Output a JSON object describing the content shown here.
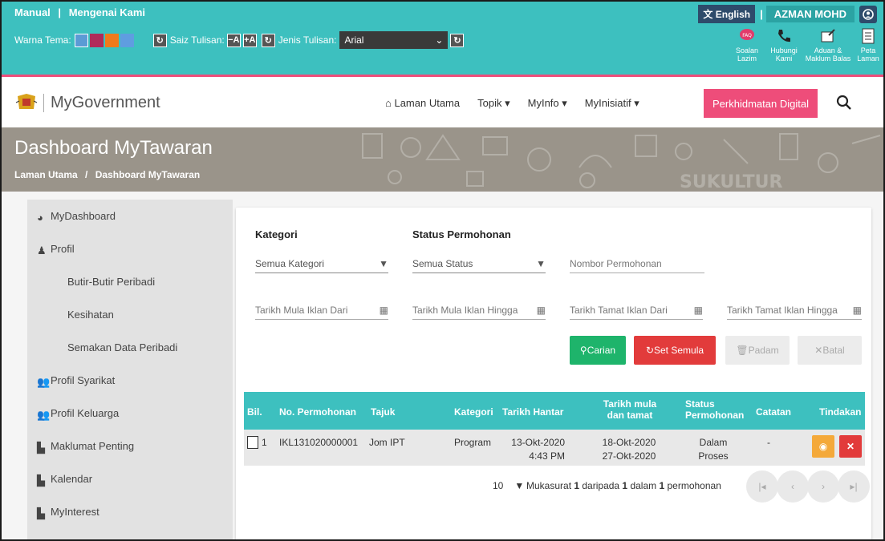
{
  "top": {
    "links": [
      "Manual",
      "|",
      "Mengenai Kami"
    ],
    "theme_label": "Warna Tema:",
    "theme_colors": [
      "#5b9bd5",
      "#b02a5a",
      "#f07a1b",
      "#5f9de0"
    ],
    "font_size_label": "Saiz Tulisan:",
    "font_minus": "−A",
    "font_plus": "+A",
    "font_type_label": "Jenis Tulisan:",
    "font_value": "Arial",
    "lang_label": "English",
    "user_sep": "|",
    "user_name": "AZMAN MOHD",
    "quick": [
      {
        "label": "Soalan Lazim",
        "icon": "faq-icon"
      },
      {
        "label": "Hubungi Kami",
        "icon": "phone-icon"
      },
      {
        "label": "Aduan & Maklum Balas",
        "icon": "feedback-icon"
      },
      {
        "label": "Peta Laman",
        "icon": "sitemap-icon"
      }
    ]
  },
  "nav": {
    "logo_text": "MyGovernment",
    "menu": [
      "Laman Utama",
      "Topik",
      "MyInfo",
      "MyInisiatif"
    ],
    "digital_button": "Perkhidmatan Digital"
  },
  "banner": {
    "title": "Dashboard MyTawaran",
    "crumb_home": "Laman Utama",
    "crumb_sep": "/",
    "crumb_current": "Dashboard MyTawaran",
    "deco_text": "SUKULTUR"
  },
  "sidebar": [
    {
      "label": "MyDashboard",
      "icon": "dashboard-icon",
      "sub": false
    },
    {
      "label": "Profil",
      "icon": "user-icon",
      "sub": false
    },
    {
      "label": "Butir-Butir Peribadi",
      "icon": "",
      "sub": true
    },
    {
      "label": "Kesihatan",
      "icon": "",
      "sub": true
    },
    {
      "label": "Semakan Data Peribadi",
      "icon": "",
      "sub": true
    },
    {
      "label": "Profil Syarikat",
      "icon": "group-icon",
      "sub": false
    },
    {
      "label": "Profil Keluarga",
      "icon": "group-icon",
      "sub": false
    },
    {
      "label": "Maklumat Penting",
      "icon": "file-icon",
      "sub": false
    },
    {
      "label": "Kalendar",
      "icon": "file-icon",
      "sub": false
    },
    {
      "label": "MyInterest",
      "icon": "file-icon",
      "sub": false
    }
  ],
  "filters": {
    "kategori_label": "Kategori",
    "status_label": "Status Permohonan",
    "kategori_value": "Semua Kategori",
    "status_value": "Semua Status",
    "nombor_placeholder": "Nombor Permohonan",
    "tarikh_mula_dari": "Tarikh Mula Iklan Dari",
    "tarikh_mula_hingga": "Tarikh Mula Iklan Hingga",
    "tarikh_tamat_dari": "Tarikh Tamat Iklan Dari",
    "tarikh_tamat_hingga": "Tarikh Tamat Iklan Hingga",
    "btn_carian": "Carian",
    "btn_set_semula": "Set Semula",
    "btn_padam": "Padam",
    "btn_batal": "Batal"
  },
  "table": {
    "headers": [
      "Bil.",
      "No. Permohonan",
      "Tajuk",
      "Kategori",
      "Tarikh Hantar",
      "Tarikh mula dan tamat",
      "Status Permohonan",
      "Catatan",
      "Tindakan"
    ],
    "rows": [
      {
        "bil": "1",
        "no": "IKL131020000001",
        "tajuk": "Jom IPT",
        "kategori": "Program",
        "hantar_date": "13-Okt-2020",
        "hantar_time": "4:43 PM",
        "mula": "18-Okt-2020",
        "tamat": "27-Okt-2020",
        "status_1": "Dalam",
        "status_2": "Proses",
        "catatan": "-"
      }
    ]
  },
  "pager": {
    "per_page": "10",
    "summary_pre": "Mukasurat ",
    "page": "1",
    "of": " daripada ",
    "pages": "1",
    "in": " dalam ",
    "count": "1",
    "unit": " permohonan"
  },
  "colors": {
    "teal": "#3dc0bf",
    "pink": "#ee4d7a",
    "green": "#1eb46b",
    "red": "#e23b3b",
    "orange": "#f4a93a"
  }
}
